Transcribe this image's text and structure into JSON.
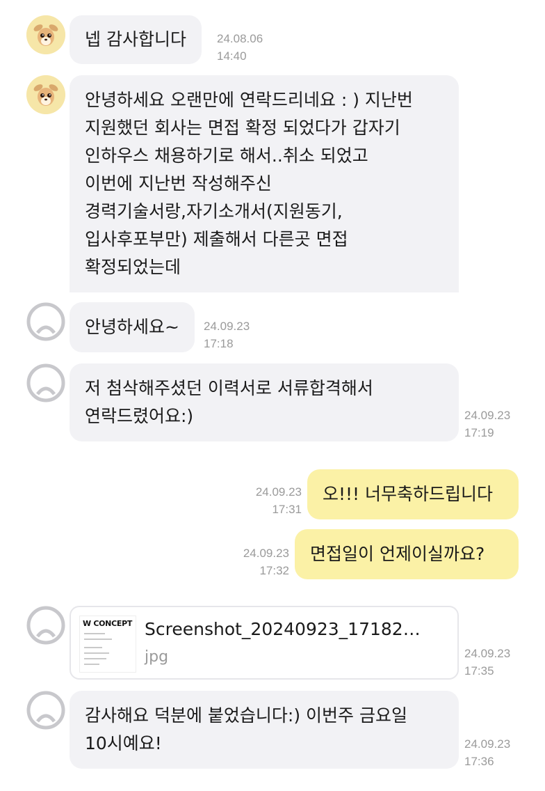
{
  "messages": [
    {
      "sender": "deer",
      "lines": [
        "넵 감사합니다"
      ],
      "date": "24.08.06",
      "time": "14:40"
    },
    {
      "sender": "deer",
      "lines": [
        "안녕하세요 오랜만에 연락드리네요 : ) 지난번",
        "지원했던 회사는 면접 확정 되었다가 갑자기",
        "인하우스 채용하기로 해서..취소 되었고",
        "이번에 지난번 작성해주신",
        "경력기술서랑,자기소개서(지원동기,",
        "입사후포부만) 제출해서 다른곳 면접",
        "확정되었는데"
      ]
    },
    {
      "sender": "default",
      "lines": [
        "안녕하세요~"
      ],
      "date": "24.09.23",
      "time": "17:18"
    },
    {
      "sender": "default",
      "lines": [
        "저 첨삭해주셨던 이력서로 서류합격해서",
        "연락드렸어요:)"
      ],
      "date": "24.09.23",
      "time": "17:19"
    },
    {
      "sender": "me",
      "lines": [
        "오!!! 너무축하드립니다"
      ],
      "date": "24.09.23",
      "time": "17:31"
    },
    {
      "sender": "me",
      "lines": [
        "면접일이 언제이실까요?"
      ],
      "date": "24.09.23",
      "time": "17:32"
    },
    {
      "sender": "default",
      "file": {
        "thumb_title": "W CONCEPT",
        "name": "Screenshot_20240923_17182…",
        "ext": "jpg"
      },
      "date": "24.09.23",
      "time": "17:35"
    },
    {
      "sender": "default",
      "lines": [
        "감사해요 덕분에 붙었습니다:) 이번주 금요일",
        "10시예요!"
      ],
      "date": "24.09.23",
      "time": "17:36"
    }
  ],
  "colors": {
    "incoming_bubble": "#f2f2f5",
    "outgoing_bubble": "#fbf1a6",
    "timestamp": "#9a9a9a"
  },
  "icons": {
    "deer_avatar": "deer-avatar-icon",
    "default_avatar": "default-profile-icon"
  }
}
